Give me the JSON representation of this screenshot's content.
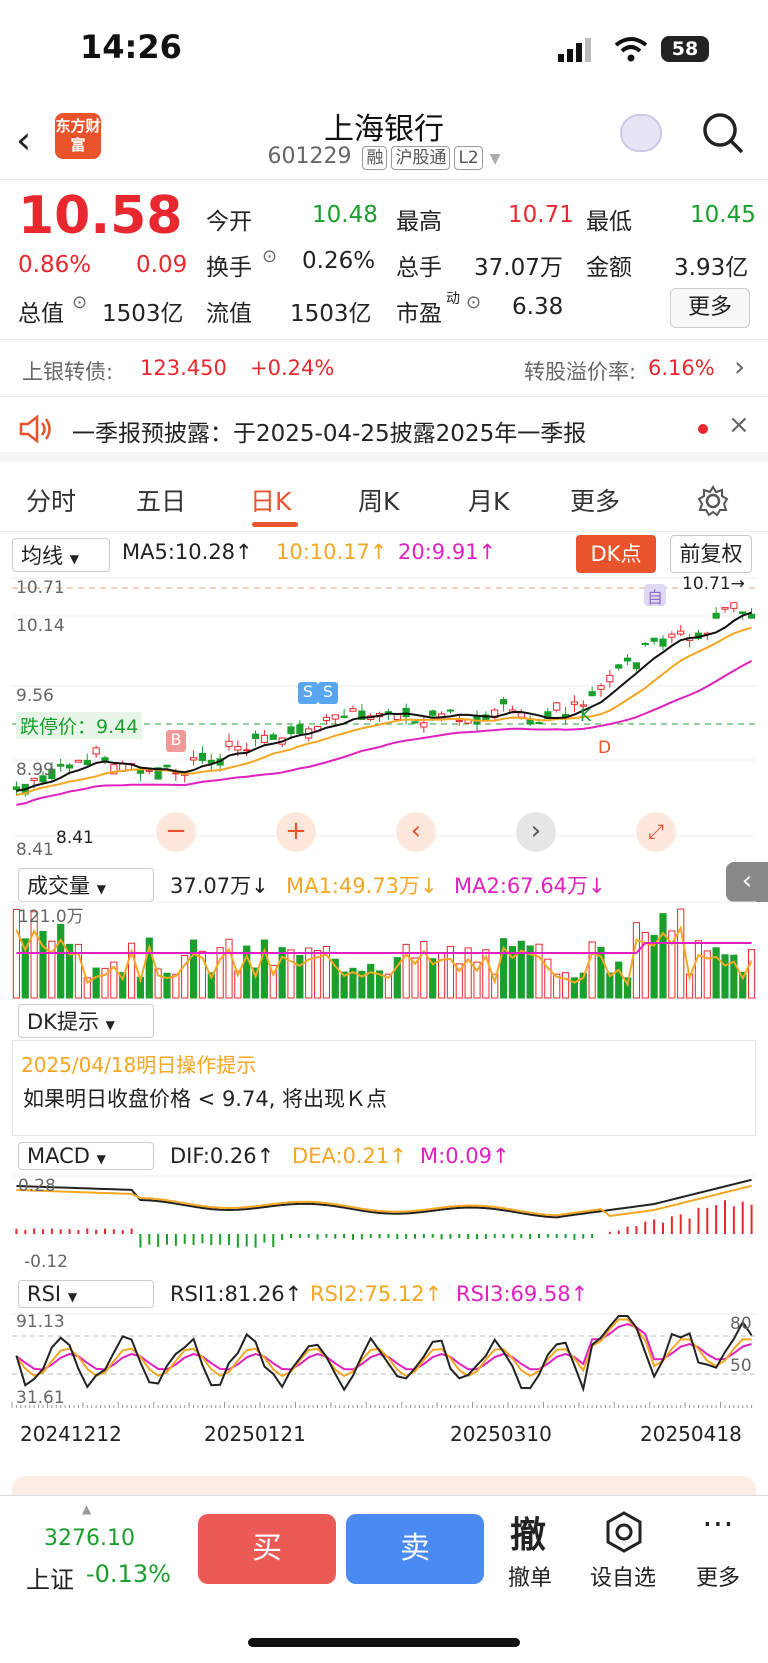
{
  "status": {
    "time": "14:26",
    "battery": "58"
  },
  "header": {
    "back_icon": "chevron-left-icon",
    "logo_text": "东方财富",
    "title": "上海银行",
    "code": "601229",
    "tags": [
      "融",
      "沪股通",
      "L2"
    ]
  },
  "quote": {
    "price": "10.58",
    "pct": "0.86%",
    "chg": "0.09",
    "open_label": "今开",
    "open": "10.48",
    "high_label": "最高",
    "high": "10.71",
    "low_label": "最低",
    "low": "10.45",
    "turnover_label": "换手",
    "turnover": "0.26%",
    "vol_label": "总手",
    "vol": "37.07万",
    "amount_label": "金额",
    "amount": "3.93亿",
    "mcap_label": "总值",
    "mcap": "1503亿",
    "float_label": "流值",
    "float": "1503亿",
    "pe_label": "市盈",
    "pe_sup": "动",
    "pe": "6.38",
    "more": "更多"
  },
  "bond": {
    "name": "上银转债:",
    "price": "123.450",
    "chg": "+0.24%",
    "premium_label": "转股溢价率:",
    "premium": "6.16%"
  },
  "notice": {
    "text": "一季报预披露：于2025-04-25披露2025年一季报"
  },
  "tabs": [
    "分时",
    "五日",
    "日K",
    "周K",
    "月K",
    "更多"
  ],
  "kline": {
    "ma_select": "均线",
    "ma5": "MA5:10.28↑",
    "ma10": "10:10.17↑",
    "ma20": "20:9.91↑",
    "dk_button": "DK点",
    "fq_button": "前复权",
    "y_top": "10.71",
    "y2": "10.14",
    "y3": "9.56",
    "y4": "8.99",
    "y_bottom": "8.41",
    "y_min_label": "8.41",
    "max_label": "10.71→",
    "limit_label": "跌停价：9.44",
    "k_label": "K",
    "d_label": "D",
    "b_label": "B",
    "s_label": "S",
    "zi_label": "自"
  },
  "volume": {
    "select": "成交量",
    "vol": "37.07万↓",
    "ma1": "MA1:49.73万↓",
    "ma2": "MA2:67.64万↓",
    "ymax": "121.0万"
  },
  "dk": {
    "select": "DK提示",
    "date": "2025/04/18明日操作提示",
    "text": "如果明日收盘价格 < 9.74, 将出现Ｋ点"
  },
  "macd": {
    "select": "MACD",
    "dif": "DIF:0.26↑",
    "dea": "DEA:0.21↑",
    "m": "M:0.09↑",
    "ytop": "0.28",
    "ybot": "-0.12"
  },
  "rsi": {
    "select": "RSI",
    "rsi1": "RSI1:81.26↑",
    "rsi2": "RSI2:75.12↑",
    "rsi3": "RSI3:69.58↑",
    "ytop": "91.13",
    "ybot": "31.61",
    "r80": "80",
    "r50": "50"
  },
  "dates": [
    "20241212",
    "20250121",
    "20250310",
    "20250418"
  ],
  "bottom": {
    "index_value": "3276.10",
    "index_name": "上证",
    "index_chg": "-0.13%",
    "buy": "买",
    "sell": "卖",
    "cancel_icon_text": "撤",
    "cancel": "撤单",
    "fav": "设自选",
    "more": "更多"
  },
  "colors": {
    "up": "#e8282e",
    "down": "#1a9e2c",
    "ma5": "#111111",
    "ma10": "#f5a623",
    "ma20": "#e020c0",
    "accent": "#e8532b"
  }
}
